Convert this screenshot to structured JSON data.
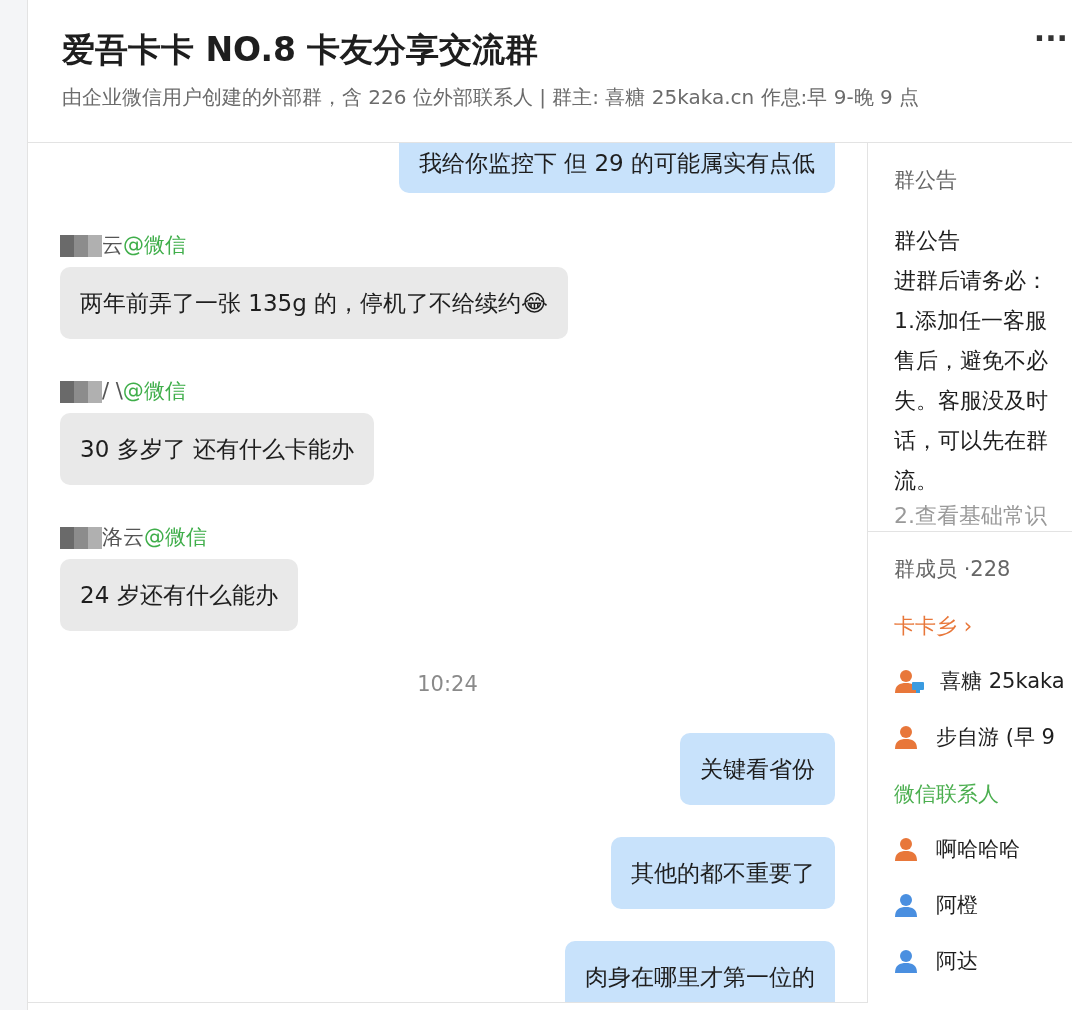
{
  "header": {
    "title": "爱吾卡卡 NO.8 卡友分享交流群",
    "subtitle": "由企业微信用户创建的外部群，含 226 位外部联系人 | 群主: 喜糖 25kaka.cn 作息:早 9-晚 9 点",
    "more": "···"
  },
  "messages": [
    {
      "kind": "sent",
      "text": "我给你监控下  但 29 的可能属实有点低"
    },
    {
      "kind": "received",
      "sender": "云",
      "source": "@微信",
      "text": "两年前弄了一张 135g 的，停机了不给续约😂"
    },
    {
      "kind": "received",
      "sender": "/ \\",
      "source": "@微信",
      "text": "30 多岁了 还有什么卡能办"
    },
    {
      "kind": "received",
      "sender": "洛云",
      "source": "@微信",
      "text": "24 岁还有什么能办"
    },
    {
      "kind": "time",
      "text": "10:24"
    },
    {
      "kind": "sent",
      "text": "关键看省份"
    },
    {
      "kind": "sent",
      "text": "其他的都不重要了"
    },
    {
      "kind": "sent",
      "text": "肉身在哪里才第一位的"
    }
  ],
  "announcement": {
    "heading": "群公告",
    "title": "群公告",
    "lines": [
      "进群后请务必：",
      "1.添加任一客服",
      "售后，避免不必",
      "失。客服没及时",
      "话，可以先在群",
      "流。",
      "2.查看基础常识"
    ]
  },
  "members": {
    "heading": "群成员 ·228",
    "groups": [
      {
        "name": "卡卡乡",
        "chevron": "›",
        "color": "#e8773a",
        "items": [
          {
            "name": "喜糖 25kaka",
            "color": "#e8773a",
            "desktop": true
          },
          {
            "name": "步自游 (早 9",
            "color": "#e8773a",
            "desktop": false
          }
        ]
      },
      {
        "name": "微信联系人",
        "color": "#4caf50",
        "items": [
          {
            "name": "啊哈哈哈",
            "color": "#e8773a",
            "desktop": false
          },
          {
            "name": "阿橙",
            "color": "#4a8fe0",
            "desktop": false
          },
          {
            "name": "阿达",
            "color": "#4a8fe0",
            "desktop": false
          }
        ]
      }
    ]
  }
}
